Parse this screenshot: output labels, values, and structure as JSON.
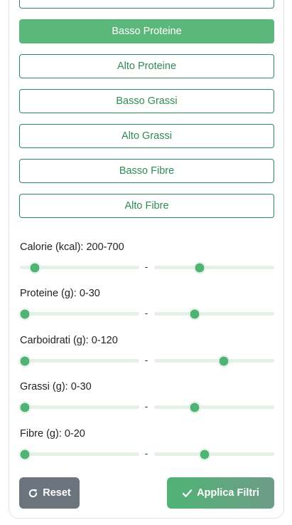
{
  "filters": {
    "partial_chip": "",
    "chips": [
      {
        "label": "Basso Proteine",
        "active": true
      },
      {
        "label": "Alto Proteine",
        "active": false
      },
      {
        "label": "Basso Grassi",
        "active": false
      },
      {
        "label": "Alto Grassi",
        "active": false
      },
      {
        "label": "Basso Fibre",
        "active": false
      },
      {
        "label": "Alto Fibre",
        "active": false
      }
    ]
  },
  "ranges": [
    {
      "label": "Calorie (kcal): 200-700",
      "min_fraction": 0.09,
      "max_fraction": 0.37
    },
    {
      "label": "Proteine (g): 0-30",
      "min_fraction": 0.0,
      "max_fraction": 0.32
    },
    {
      "label": "Carboidrati (g): 0-120",
      "min_fraction": 0.0,
      "max_fraction": 0.59
    },
    {
      "label": "Grassi (g): 0-30",
      "min_fraction": 0.0,
      "max_fraction": 0.32
    },
    {
      "label": "Fibre (g): 0-20",
      "min_fraction": 0.0,
      "max_fraction": 0.41
    }
  ],
  "range_separator": "-",
  "actions": {
    "reset_label": "Reset",
    "apply_label": "Applica Filtri"
  },
  "colors": {
    "accent": "#5cb87a",
    "outline": "#2e8b57",
    "reset": "#6c757d"
  }
}
